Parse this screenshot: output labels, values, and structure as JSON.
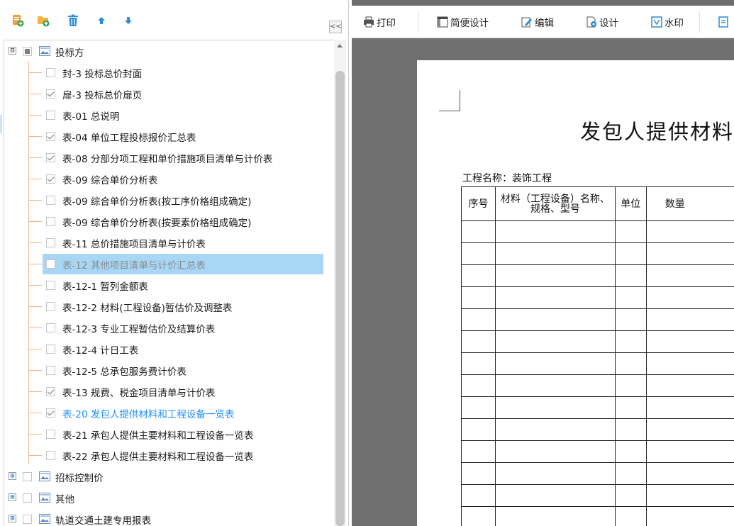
{
  "left_toolbar": {
    "icons": [
      "add-report-icon",
      "add-folder-icon",
      "delete-icon",
      "move-up-icon",
      "move-down-icon"
    ],
    "collapse_label": "<<"
  },
  "tree": {
    "root": {
      "label": "投标方",
      "expanded": true,
      "expander": "⊟"
    },
    "items": [
      {
        "label": "封-3 投标总价封面",
        "checked": false
      },
      {
        "label": "扉-3 投标总价扉页",
        "checked": true
      },
      {
        "label": "表-01 总说明",
        "checked": false
      },
      {
        "label": "表-04 单位工程投标报价汇总表",
        "checked": true
      },
      {
        "label": "表-08 分部分项工程和单价措施项目清单与计价表",
        "checked": true
      },
      {
        "label": "表-09 综合单价分析表",
        "checked": true
      },
      {
        "label": "表-09 综合单价分析表(按工序价格组成确定)",
        "checked": false
      },
      {
        "label": "表-09 综合单价分析表(按要素价格组成确定)",
        "checked": false
      },
      {
        "label": "表-11 总价措施项目清单与计价表",
        "checked": false
      },
      {
        "label": "表-12 其他项目清单与计价汇总表",
        "checked": false,
        "selected": true
      },
      {
        "label": "表-12-1 暂列金额表",
        "checked": false
      },
      {
        "label": "表-12-2 材料(工程设备)暂估价及调整表",
        "checked": false
      },
      {
        "label": "表-12-3 专业工程暂估价及结算价表",
        "checked": false
      },
      {
        "label": "表-12-4 计日工表",
        "checked": false
      },
      {
        "label": "表-12-5 总承包服务费计价表",
        "checked": false
      },
      {
        "label": "表-13 规费、税金项目清单与计价表",
        "checked": true
      },
      {
        "label": "表-20 发包人提供材料和工程设备一览表",
        "checked": true,
        "active": true
      },
      {
        "label": "表-21 承包人提供主要材料和工程设备一览表",
        "checked": false
      },
      {
        "label": "表-22 承包人提供主要材料和工程设备一览表",
        "checked": false
      }
    ],
    "groups": [
      {
        "label": "招标控制价",
        "expander": "⊞"
      },
      {
        "label": "其他",
        "expander": "⊞"
      },
      {
        "label": "轨道交通土建专用报表",
        "expander": "⊞"
      }
    ]
  },
  "right_toolbar": {
    "print": "打印",
    "simple_design": "简便设计",
    "edit": "编辑",
    "design": "设计",
    "watermark": "水印"
  },
  "document": {
    "title": "发包人提供材料",
    "project_name": "工程名称：装饰工程",
    "columns": [
      "序号",
      "材料（工程设备）名称、规格、型号",
      "单位",
      "数量"
    ],
    "empty_rows": 14
  },
  "colors": {
    "selection": "#a8d7f5",
    "active_text": "#1e90ff",
    "tree_lines": "#f2b28a",
    "preview_bg": "#707070"
  }
}
